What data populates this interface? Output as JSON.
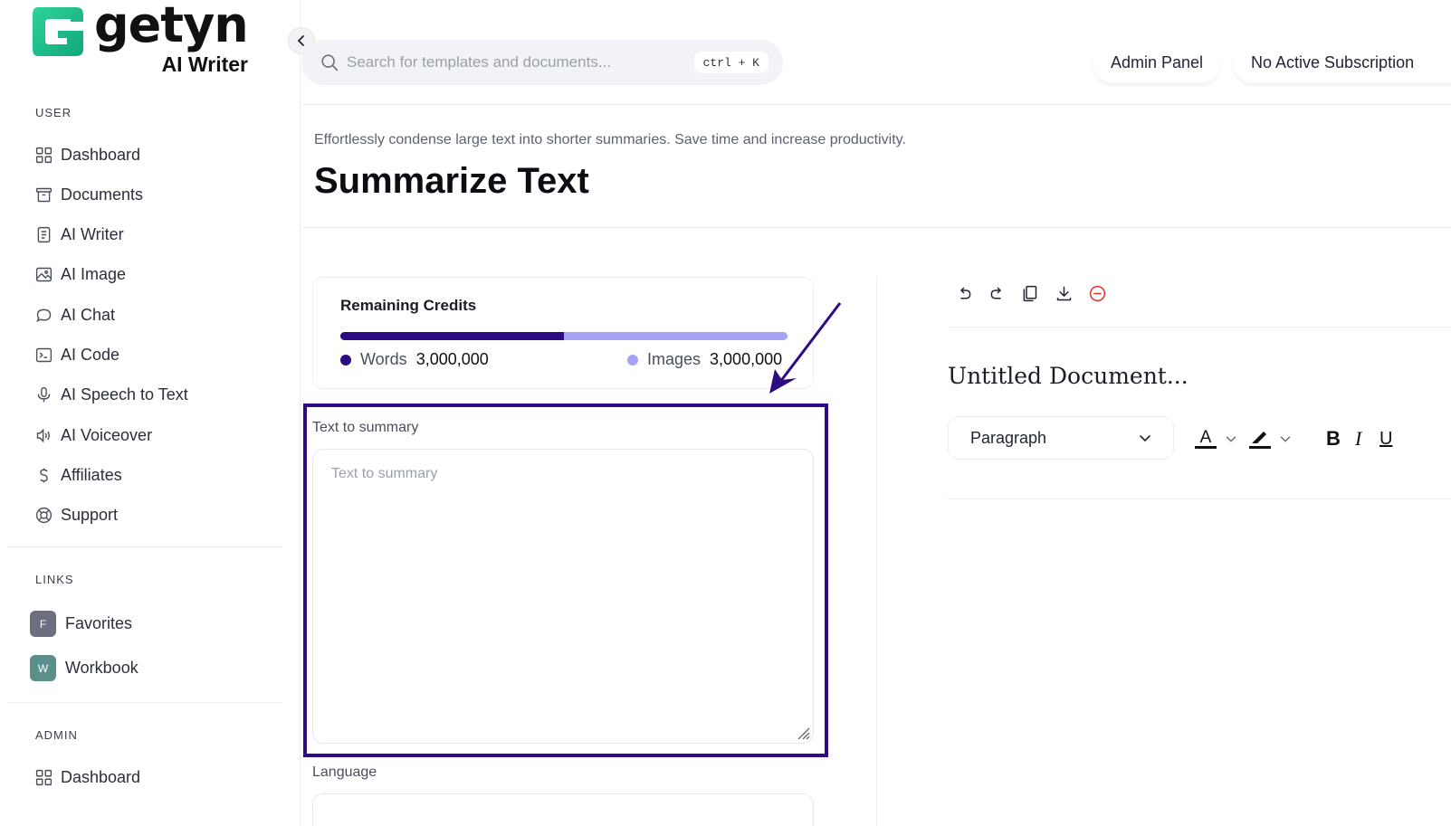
{
  "brand": {
    "name": "getyn",
    "sub": "AI Writer",
    "accent": "#2d0b82",
    "logo_color": "#1fb98a"
  },
  "sidebar": {
    "user_section": "USER",
    "user_items": [
      {
        "label": "Dashboard",
        "icon": "grid-icon"
      },
      {
        "label": "Documents",
        "icon": "archive-icon"
      },
      {
        "label": "AI Writer",
        "icon": "file-text-icon"
      },
      {
        "label": "AI Image",
        "icon": "image-icon"
      },
      {
        "label": "AI Chat",
        "icon": "chat-bubble-icon"
      },
      {
        "label": "AI Code",
        "icon": "terminal-icon"
      },
      {
        "label": "AI Speech to Text",
        "icon": "microphone-icon"
      },
      {
        "label": "AI Voiceover",
        "icon": "speaker-icon"
      },
      {
        "label": "Affiliates",
        "icon": "dollar-icon"
      },
      {
        "label": "Support",
        "icon": "lifebuoy-icon"
      }
    ],
    "links_section": "LINKS",
    "links": [
      {
        "badge": "F",
        "label": "Favorites",
        "color": "#6b6f80"
      },
      {
        "badge": "W",
        "label": "Workbook",
        "color": "#5b8f8a"
      }
    ],
    "admin_section": "ADMIN",
    "admin_items": [
      {
        "label": "Dashboard",
        "icon": "grid-icon"
      }
    ]
  },
  "header": {
    "search_placeholder": "Search for templates and documents...",
    "shortcut": "ctrl + K",
    "admin_panel": "Admin Panel",
    "subscription": "No Active Subscription"
  },
  "page": {
    "subtitle": "Effortlessly condense large text into shorter summaries. Save time and increase productivity.",
    "title": "Summarize Text"
  },
  "credits": {
    "title": "Remaining Credits",
    "words_label": "Words",
    "words_value": "3,000,000",
    "images_label": "Images",
    "images_value": "3,000,000",
    "words_fraction": 0.5,
    "words_color": "#2d0b82",
    "images_color": "#a7a3f4"
  },
  "form": {
    "text_label": "Text to summary",
    "text_placeholder": "Text to summary",
    "language_label": "Language"
  },
  "editor": {
    "doc_title": "Untitled Document...",
    "block_type": "Paragraph",
    "tools": [
      "undo-icon",
      "redo-icon",
      "copy-icon",
      "download-icon",
      "delete-icon"
    ],
    "bold": "B",
    "italic": "I",
    "underline": "U",
    "text_color_glyph": "A"
  }
}
